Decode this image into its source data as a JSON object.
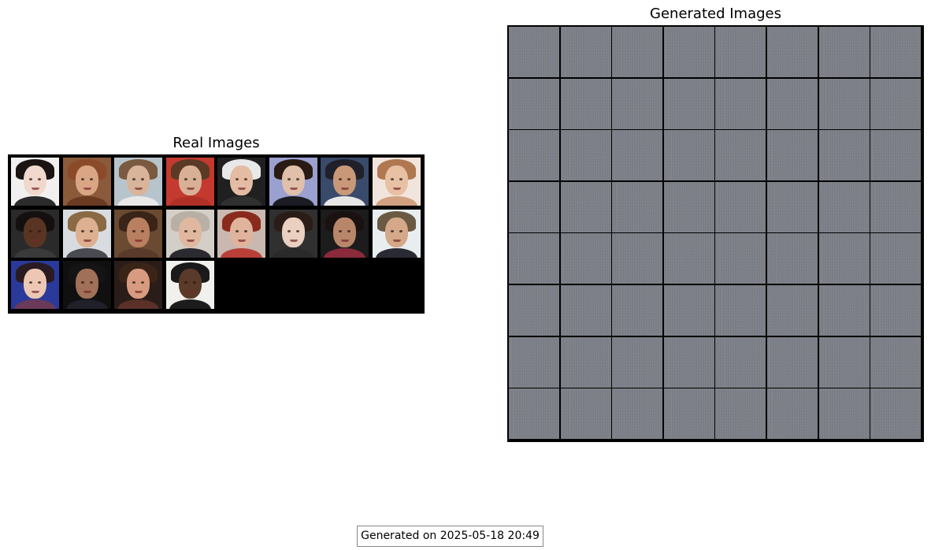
{
  "real_panel": {
    "title": "Real Images"
  },
  "generated_panel": {
    "title": "Generated Images"
  },
  "footer": {
    "timestamp": "Generated on 2025-05-18 20:49"
  },
  "real_faces": [
    {
      "bg": "#f2f0ee",
      "skin": "#f0d8cc",
      "hair": "#1a1412",
      "cloth": "#2b2b2b"
    },
    {
      "bg": "#8a5a3a",
      "skin": "#d9a585",
      "hair": "#8b4a2a",
      "cloth": "#6b3a22"
    },
    {
      "bg": "#b8c4cc",
      "skin": "#d8b49a",
      "hair": "#7a5a40",
      "cloth": "#e8e8e8"
    },
    {
      "bg": "#c43a2e",
      "skin": "#d8b096",
      "hair": "#5a3a24",
      "cloth": "#b03028"
    },
    {
      "bg": "#202020",
      "skin": "#e4bca4",
      "hair": "#e8e8e8",
      "cloth": "#303030"
    },
    {
      "bg": "#9aa0d0",
      "skin": "#e0c0aa",
      "hair": "#2a1a14",
      "cloth": "#1c1c24"
    },
    {
      "bg": "#3a4a6a",
      "skin": "#c89878",
      "hair": "#20202a",
      "cloth": "#e6e6e6"
    },
    {
      "bg": "#f0e4dc",
      "skin": "#e8c0a4",
      "hair": "#b07850",
      "cloth": "#d0a080"
    },
    {
      "bg": "#2a2a2a",
      "skin": "#5a3422",
      "hair": "#141010",
      "cloth": "#3a3a3a"
    },
    {
      "bg": "#d8dce0",
      "skin": "#dcb090",
      "hair": "#8a6a44",
      "cloth": "#4a4a52"
    },
    {
      "bg": "#6a4a30",
      "skin": "#b88060",
      "hair": "#3a2418",
      "cloth": "#5a3a2a"
    },
    {
      "bg": "#d4cec8",
      "skin": "#e0b8a0",
      "hair": "#b8b0a4",
      "cloth": "#2a2a30"
    },
    {
      "bg": "#c8b8b0",
      "skin": "#e0b49c",
      "hair": "#8a2a1c",
      "cloth": "#b84038"
    },
    {
      "bg": "#303030",
      "skin": "#ead0c0",
      "hair": "#2a1c16",
      "cloth": "#2a2a2a"
    },
    {
      "bg": "#1c1c1c",
      "skin": "#b8866a",
      "hair": "#1a1210",
      "cloth": "#8a2a3a"
    },
    {
      "bg": "#e8eef0",
      "skin": "#d4a888",
      "hair": "#6a5a44",
      "cloth": "#2a2a34"
    },
    {
      "bg": "#2a3a9a",
      "skin": "#ecc8b4",
      "hair": "#2a1a22",
      "cloth": "#6a3a5a"
    },
    {
      "bg": "#101010",
      "skin": "#a07058",
      "hair": "#141414",
      "cloth": "#202028"
    },
    {
      "bg": "#2a1c18",
      "skin": "#d89a80",
      "hair": "#3a2418",
      "cloth": "#5a3028"
    },
    {
      "bg": "#f0f0ec",
      "skin": "#5a3a28",
      "hair": "#1a1a1a",
      "cloth": "#1c1c1c"
    }
  ]
}
